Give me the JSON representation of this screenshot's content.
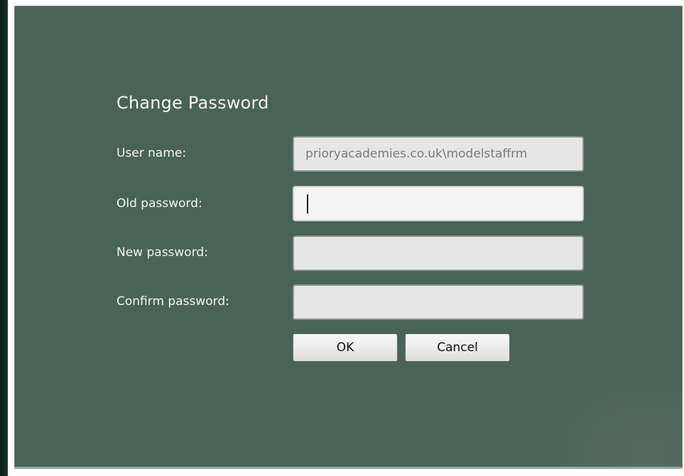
{
  "dialog": {
    "title": "Change Password",
    "fields": [
      {
        "label": "User name:",
        "value": "prioryacademies.co.uk\\modelstaffrm",
        "placeholder": ""
      },
      {
        "label": "Old password:",
        "value": "",
        "placeholder": ""
      },
      {
        "label": "New password:",
        "value": "",
        "placeholder": ""
      },
      {
        "label": "Confirm password:",
        "value": "",
        "placeholder": ""
      }
    ],
    "buttons": {
      "ok_label": "OK",
      "cancel_label": "Cancel"
    }
  },
  "colors": {
    "panel_background": "#4a6358",
    "field_background": "#e6e6e6",
    "active_field_background": "#f5f5f5",
    "text_light": "#f3f6f4"
  }
}
